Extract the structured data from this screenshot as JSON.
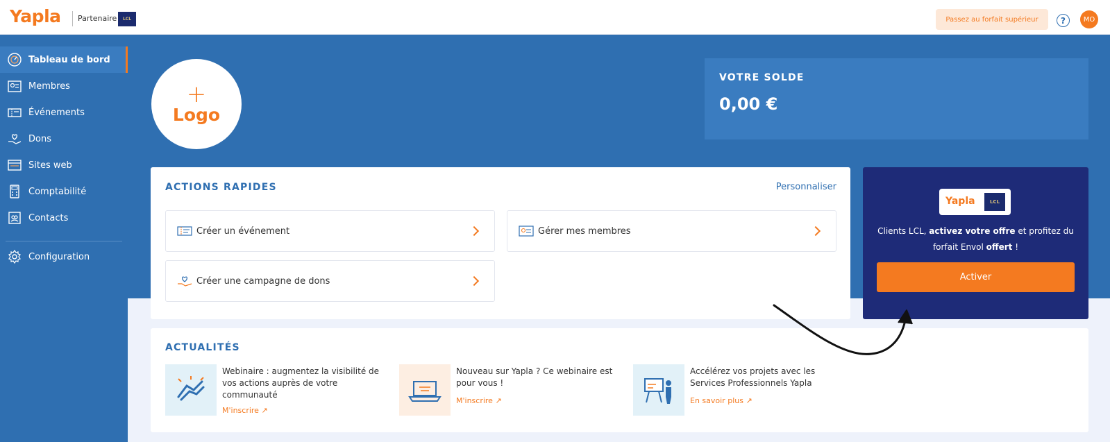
{
  "header": {
    "brand": "Yapla",
    "partner_label": "Partenaire",
    "partner_badge": "LCL",
    "upgrade_label": "Passez au forfait supérieur",
    "help_glyph": "?",
    "avatar_initials": "MO"
  },
  "sidebar": {
    "items": [
      {
        "label": "Tableau de bord",
        "icon": "dashboard-icon",
        "active": true
      },
      {
        "label": "Membres",
        "icon": "members-icon"
      },
      {
        "label": "Événements",
        "icon": "events-icon"
      },
      {
        "label": "Dons",
        "icon": "donations-icon"
      },
      {
        "label": "Sites web",
        "icon": "website-icon"
      },
      {
        "label": "Comptabilité",
        "icon": "accounting-icon"
      },
      {
        "label": "Contacts",
        "icon": "contacts-icon"
      },
      {
        "label": "Configuration",
        "icon": "gear-icon"
      }
    ]
  },
  "hero": {
    "logo_plus": "+",
    "logo_text": "Logo",
    "balance_label": "VOTRE SOLDE",
    "balance_value": "0,00 €"
  },
  "quick_actions": {
    "title": "ACTIONS RAPIDES",
    "customize_label": "Personnaliser",
    "actions": [
      {
        "label": "Créer un événement",
        "icon": "event-ticket-icon"
      },
      {
        "label": "Gérer mes membres",
        "icon": "member-card-icon"
      },
      {
        "label": "Créer une campagne de dons",
        "icon": "donation-hand-icon"
      }
    ]
  },
  "promo": {
    "brand": "Yapla",
    "partner_badge": "LCL",
    "text_part1": "Clients LCL, ",
    "text_bold1": "activez votre offre",
    "text_part2": " et profitez du forfait Envol ",
    "text_bold2": "offert",
    "text_part3": " !",
    "button_label": "Activer"
  },
  "news": {
    "title": "ACTUALITÉS",
    "items": [
      {
        "title": "Webinaire : augmentez la visibilité de vos actions auprès de votre communauté",
        "link": "M'inscrire",
        "thumb": "handshake-icon",
        "thumb_bg": "#e2f1f8"
      },
      {
        "title": "Nouveau sur Yapla ? Ce webinaire est pour vous !",
        "link": "M'inscrire",
        "thumb": "laptop-icon",
        "thumb_bg": "#fdeee2"
      },
      {
        "title": "Accélérez vos projets avec les Services Professionnels Yapla",
        "link": "En savoir plus",
        "thumb": "presentation-icon",
        "thumb_bg": "#e2f1f8"
      }
    ]
  },
  "colors": {
    "primary_blue": "#2f6fb1",
    "accent_orange": "#f47a20",
    "promo_navy": "#1e2b78"
  }
}
